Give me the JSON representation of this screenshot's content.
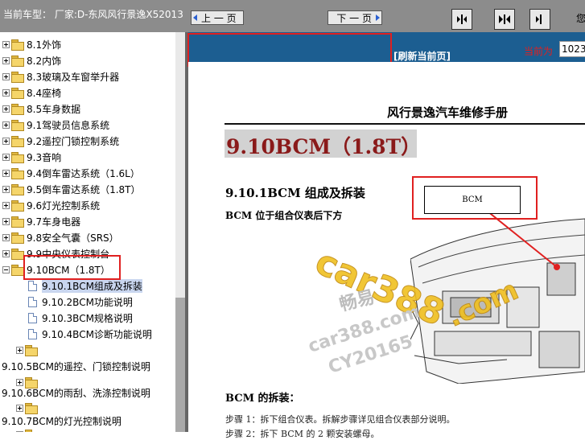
{
  "topbar": {
    "title": "当前车型：  厂家:D-东风风行景逸X52013",
    "btn_first": "first-page-icon",
    "btn_fit": "fit-width-icon",
    "btn_next": "single-page-icon",
    "cut_text": "您"
  },
  "tree": {
    "items": [
      {
        "label": "8.1外饰"
      },
      {
        "label": "8.2内饰"
      },
      {
        "label": "8.3玻璃及车窗举升器"
      },
      {
        "label": "8.4座椅"
      },
      {
        "label": "8.5车身数据"
      },
      {
        "label": "9.1驾驶员信息系统"
      },
      {
        "label": "9.2遥控门锁控制系统"
      },
      {
        "label": "9.3音响"
      },
      {
        "label": "9.4倒车雷达系统（1.6L）"
      },
      {
        "label": "9.5倒车雷达系统（1.8T）"
      },
      {
        "label": "9.6灯光控制系统"
      },
      {
        "label": "9.7车身电器"
      },
      {
        "label": "9.8安全气囊（SRS）"
      },
      {
        "label": "9.9中央仪表控制台"
      },
      {
        "label": "9.10BCM（1.8T）"
      }
    ],
    "children": [
      {
        "label": "9.10.1BCM组成及拆装"
      },
      {
        "label": "9.10.2BCM功能说明"
      },
      {
        "label": "9.10.3BCM规格说明"
      },
      {
        "label": "9.10.4BCM诊断功能说明"
      }
    ],
    "lower": [
      {
        "label": "9.10.5BCM的遥控、门锁控制说明"
      },
      {
        "label": "9.10.6BCM的雨刮、洗涤控制说明"
      },
      {
        "label": "9.10.7BCM的灯光控制说明"
      }
    ]
  },
  "nav": {
    "prev_label": "上 一 页",
    "next_label": "下 一 页",
    "refresh_label": "[刷新当前页]",
    "current_label": "当前为",
    "current_value": "1023"
  },
  "doc": {
    "manual_title": "风行景逸汽车维修手册",
    "chapter": "9.10BCM（1.8T）",
    "section": "9.10.1BCM 组成及拆装",
    "sub": "BCM 位于组合仪表后下方",
    "bcm_label": "BCM",
    "remove_title": "BCM 的拆装：",
    "step1": "步骤 1：拆下组合仪表。拆解步骤详见组合仪表部分说明。",
    "step2": "步骤 2：拆下 BCM 的 2 颗安装螺母。"
  },
  "watermark": {
    "main": "car388",
    "cn": "畅易",
    "com": ".com",
    "sub1": "car388.com",
    "sub2": "CY20165"
  },
  "colors": {
    "topbar": "#8c8c8c",
    "navbar": "#1c5e91",
    "highlight": "#e02020",
    "chapter_text": "#8a1a1a"
  }
}
